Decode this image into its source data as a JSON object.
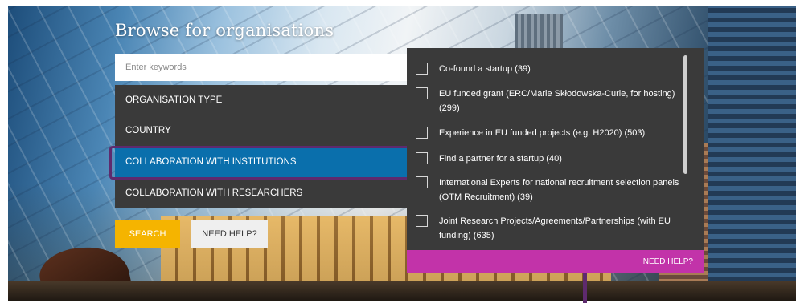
{
  "page": {
    "title": "Browse for organisations"
  },
  "search": {
    "placeholder": "Enter keywords",
    "value": ""
  },
  "filters": [
    {
      "label": "ORGANISATION TYPE",
      "active": false
    },
    {
      "label": "COUNTRY",
      "active": false
    },
    {
      "label": "COLLABORATION WITH INSTITUTIONS",
      "active": true
    },
    {
      "label": "COLLABORATION WITH RESEARCHERS",
      "active": false
    }
  ],
  "buttons": {
    "search_label": "SEARCH",
    "help_label": "NEED HELP?"
  },
  "dropdown": {
    "options": [
      {
        "label": "Co-found a startup (39)",
        "checked": false
      },
      {
        "label": "EU funded grant (ERC/Marie Skłodowska-Curie, for hosting) (299)",
        "checked": false
      },
      {
        "label": "Experience in EU funded projects (e.g. H2020) (503)",
        "checked": false
      },
      {
        "label": "Find a partner for a startup (40)",
        "checked": false
      },
      {
        "label": "International Experts for national recruitment selection panels (OTM Recruitment) (39)",
        "checked": false
      },
      {
        "label": "Joint Research Projects/Agreements/Partnerships (with EU funding) (635)",
        "checked": false
      }
    ],
    "help_label": "NEED HELP?"
  },
  "colors": {
    "active_filter": "#0a6fac",
    "active_outline": "#5e2a6e",
    "search_button": "#f5b400",
    "dropdown_help": "#c233a9",
    "panel_bg": "#3a3a3a"
  }
}
